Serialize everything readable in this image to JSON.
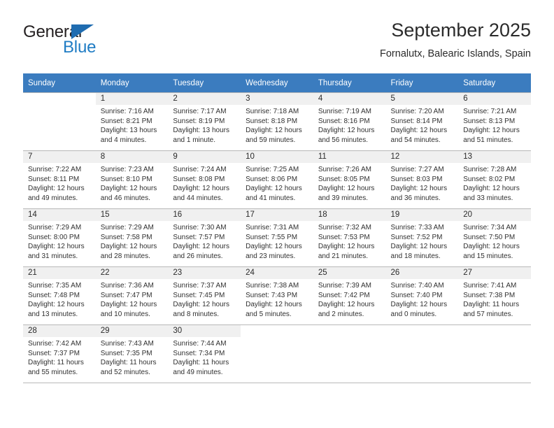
{
  "logo": {
    "word_top": "General",
    "word_bottom": "Blue",
    "triangle_color": "#1f6cb0",
    "blue_color": "#1f7cc4"
  },
  "header": {
    "title": "September 2025",
    "location": "Fornalutx, Balearic Islands, Spain"
  },
  "theme": {
    "header_row_bg": "#3b7cbf",
    "daynum_bg": "#f0f0f0",
    "grid_line": "#b8b8b8"
  },
  "weekdays": [
    "Sunday",
    "Monday",
    "Tuesday",
    "Wednesday",
    "Thursday",
    "Friday",
    "Saturday"
  ],
  "weeks": [
    [
      {
        "day": "",
        "lines": []
      },
      {
        "day": "1",
        "lines": [
          "Sunrise: 7:16 AM",
          "Sunset: 8:21 PM",
          "Daylight: 13 hours",
          "and 4 minutes."
        ]
      },
      {
        "day": "2",
        "lines": [
          "Sunrise: 7:17 AM",
          "Sunset: 8:19 PM",
          "Daylight: 13 hours",
          "and 1 minute."
        ]
      },
      {
        "day": "3",
        "lines": [
          "Sunrise: 7:18 AM",
          "Sunset: 8:18 PM",
          "Daylight: 12 hours",
          "and 59 minutes."
        ]
      },
      {
        "day": "4",
        "lines": [
          "Sunrise: 7:19 AM",
          "Sunset: 8:16 PM",
          "Daylight: 12 hours",
          "and 56 minutes."
        ]
      },
      {
        "day": "5",
        "lines": [
          "Sunrise: 7:20 AM",
          "Sunset: 8:14 PM",
          "Daylight: 12 hours",
          "and 54 minutes."
        ]
      },
      {
        "day": "6",
        "lines": [
          "Sunrise: 7:21 AM",
          "Sunset: 8:13 PM",
          "Daylight: 12 hours",
          "and 51 minutes."
        ]
      }
    ],
    [
      {
        "day": "7",
        "lines": [
          "Sunrise: 7:22 AM",
          "Sunset: 8:11 PM",
          "Daylight: 12 hours",
          "and 49 minutes."
        ]
      },
      {
        "day": "8",
        "lines": [
          "Sunrise: 7:23 AM",
          "Sunset: 8:10 PM",
          "Daylight: 12 hours",
          "and 46 minutes."
        ]
      },
      {
        "day": "9",
        "lines": [
          "Sunrise: 7:24 AM",
          "Sunset: 8:08 PM",
          "Daylight: 12 hours",
          "and 44 minutes."
        ]
      },
      {
        "day": "10",
        "lines": [
          "Sunrise: 7:25 AM",
          "Sunset: 8:06 PM",
          "Daylight: 12 hours",
          "and 41 minutes."
        ]
      },
      {
        "day": "11",
        "lines": [
          "Sunrise: 7:26 AM",
          "Sunset: 8:05 PM",
          "Daylight: 12 hours",
          "and 39 minutes."
        ]
      },
      {
        "day": "12",
        "lines": [
          "Sunrise: 7:27 AM",
          "Sunset: 8:03 PM",
          "Daylight: 12 hours",
          "and 36 minutes."
        ]
      },
      {
        "day": "13",
        "lines": [
          "Sunrise: 7:28 AM",
          "Sunset: 8:02 PM",
          "Daylight: 12 hours",
          "and 33 minutes."
        ]
      }
    ],
    [
      {
        "day": "14",
        "lines": [
          "Sunrise: 7:29 AM",
          "Sunset: 8:00 PM",
          "Daylight: 12 hours",
          "and 31 minutes."
        ]
      },
      {
        "day": "15",
        "lines": [
          "Sunrise: 7:29 AM",
          "Sunset: 7:58 PM",
          "Daylight: 12 hours",
          "and 28 minutes."
        ]
      },
      {
        "day": "16",
        "lines": [
          "Sunrise: 7:30 AM",
          "Sunset: 7:57 PM",
          "Daylight: 12 hours",
          "and 26 minutes."
        ]
      },
      {
        "day": "17",
        "lines": [
          "Sunrise: 7:31 AM",
          "Sunset: 7:55 PM",
          "Daylight: 12 hours",
          "and 23 minutes."
        ]
      },
      {
        "day": "18",
        "lines": [
          "Sunrise: 7:32 AM",
          "Sunset: 7:53 PM",
          "Daylight: 12 hours",
          "and 21 minutes."
        ]
      },
      {
        "day": "19",
        "lines": [
          "Sunrise: 7:33 AM",
          "Sunset: 7:52 PM",
          "Daylight: 12 hours",
          "and 18 minutes."
        ]
      },
      {
        "day": "20",
        "lines": [
          "Sunrise: 7:34 AM",
          "Sunset: 7:50 PM",
          "Daylight: 12 hours",
          "and 15 minutes."
        ]
      }
    ],
    [
      {
        "day": "21",
        "lines": [
          "Sunrise: 7:35 AM",
          "Sunset: 7:48 PM",
          "Daylight: 12 hours",
          "and 13 minutes."
        ]
      },
      {
        "day": "22",
        "lines": [
          "Sunrise: 7:36 AM",
          "Sunset: 7:47 PM",
          "Daylight: 12 hours",
          "and 10 minutes."
        ]
      },
      {
        "day": "23",
        "lines": [
          "Sunrise: 7:37 AM",
          "Sunset: 7:45 PM",
          "Daylight: 12 hours",
          "and 8 minutes."
        ]
      },
      {
        "day": "24",
        "lines": [
          "Sunrise: 7:38 AM",
          "Sunset: 7:43 PM",
          "Daylight: 12 hours",
          "and 5 minutes."
        ]
      },
      {
        "day": "25",
        "lines": [
          "Sunrise: 7:39 AM",
          "Sunset: 7:42 PM",
          "Daylight: 12 hours",
          "and 2 minutes."
        ]
      },
      {
        "day": "26",
        "lines": [
          "Sunrise: 7:40 AM",
          "Sunset: 7:40 PM",
          "Daylight: 12 hours",
          "and 0 minutes."
        ]
      },
      {
        "day": "27",
        "lines": [
          "Sunrise: 7:41 AM",
          "Sunset: 7:38 PM",
          "Daylight: 11 hours",
          "and 57 minutes."
        ]
      }
    ],
    [
      {
        "day": "28",
        "lines": [
          "Sunrise: 7:42 AM",
          "Sunset: 7:37 PM",
          "Daylight: 11 hours",
          "and 55 minutes."
        ]
      },
      {
        "day": "29",
        "lines": [
          "Sunrise: 7:43 AM",
          "Sunset: 7:35 PM",
          "Daylight: 11 hours",
          "and 52 minutes."
        ]
      },
      {
        "day": "30",
        "lines": [
          "Sunrise: 7:44 AM",
          "Sunset: 7:34 PM",
          "Daylight: 11 hours",
          "and 49 minutes."
        ]
      },
      {
        "day": "",
        "lines": []
      },
      {
        "day": "",
        "lines": []
      },
      {
        "day": "",
        "lines": []
      },
      {
        "day": "",
        "lines": []
      }
    ]
  ]
}
